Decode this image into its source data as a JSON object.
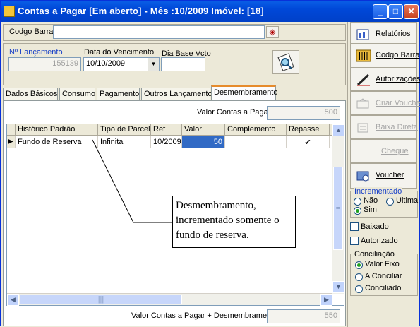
{
  "window": {
    "title": "Contas a Pagar [Em aberto] - Mês :10/2009 Imóvel: [18]"
  },
  "header": {
    "codigo_barra_label": "Codgo Barra",
    "codigo_barra_value": "",
    "lancamento_label": "Nº Lançamento",
    "lancamento_value": "155139",
    "vencimento_label": "Data do Vencimento",
    "vencimento_value": "10/10/2009",
    "dia_base_label": "Dia Base Vcto",
    "dia_base_value": ""
  },
  "tabs": [
    "Dados Básicos",
    "Consumo",
    "Pagamento",
    "Outros Lançamentos",
    "Desmembramento"
  ],
  "active_tab": "Desmembramento",
  "panel": {
    "valor_contas_label": "Valor Contas a Pagar",
    "valor_contas_value": "500",
    "total_label": "Valor Contas a Pagar + Desmembramento",
    "total_value": "550"
  },
  "grid": {
    "columns": [
      "Histórico Padrão",
      "Tipo de Parcela",
      "Ref",
      "Valor",
      "Complemento",
      "Repasse"
    ],
    "rows": [
      {
        "historico": "Fundo de Reserva",
        "tipo": "Infinita",
        "ref": "10/2009",
        "valor": "50",
        "complemento": "",
        "repasse": "✔"
      }
    ]
  },
  "callout": {
    "text": "Desmembramento, incrementado somente o fundo de reserva."
  },
  "sidebar": {
    "buttons": [
      {
        "label": "Relatórios",
        "enabled": true
      },
      {
        "label": "Codgo Barra",
        "enabled": true
      },
      {
        "label": "Autorizações",
        "enabled": true
      },
      {
        "label": "Criar Voucher",
        "enabled": false
      },
      {
        "label": "Baixa Direta",
        "enabled": false
      },
      {
        "label": "Cheque",
        "enabled": false
      },
      {
        "label": "Voucher",
        "enabled": true
      }
    ],
    "incrementado_label": "Incrementado",
    "incrementado_options": [
      "Não",
      "Ultima",
      "Sim"
    ],
    "incrementado_selected": "Sim",
    "baixado_label": "Baixado",
    "autorizado_label": "Autorizado",
    "conciliacao_label": "Conciliação",
    "conciliacao_options": [
      "Valor Fixo",
      "A Conciliar",
      "Conciliado"
    ],
    "conciliacao_selected": "Valor Fixo"
  },
  "colors": {
    "titlebar": "#0048D8",
    "selected_cell": "#316AC5",
    "active_tab_accent": "#E68B2C"
  }
}
